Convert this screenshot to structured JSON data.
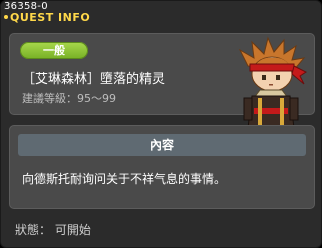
{
  "window": {
    "quest_id": "36358-0",
    "title": "QUEST INFO"
  },
  "info": {
    "category_badge": "一般",
    "quest_name": "［艾琳森林］墮落的精灵",
    "recommended_level": "建議等級：95～99",
    "npc_icon": "npc-character-portrait"
  },
  "content": {
    "header": "內容",
    "description": "向德斯托耐询问关于不祥气息的事情。"
  },
  "status": {
    "text": "狀態： 可開始"
  },
  "colors": {
    "title": "#ffd84a",
    "badge": "#8cc63f",
    "panel": "#4a4a4a",
    "background": "#2b2b2b"
  }
}
